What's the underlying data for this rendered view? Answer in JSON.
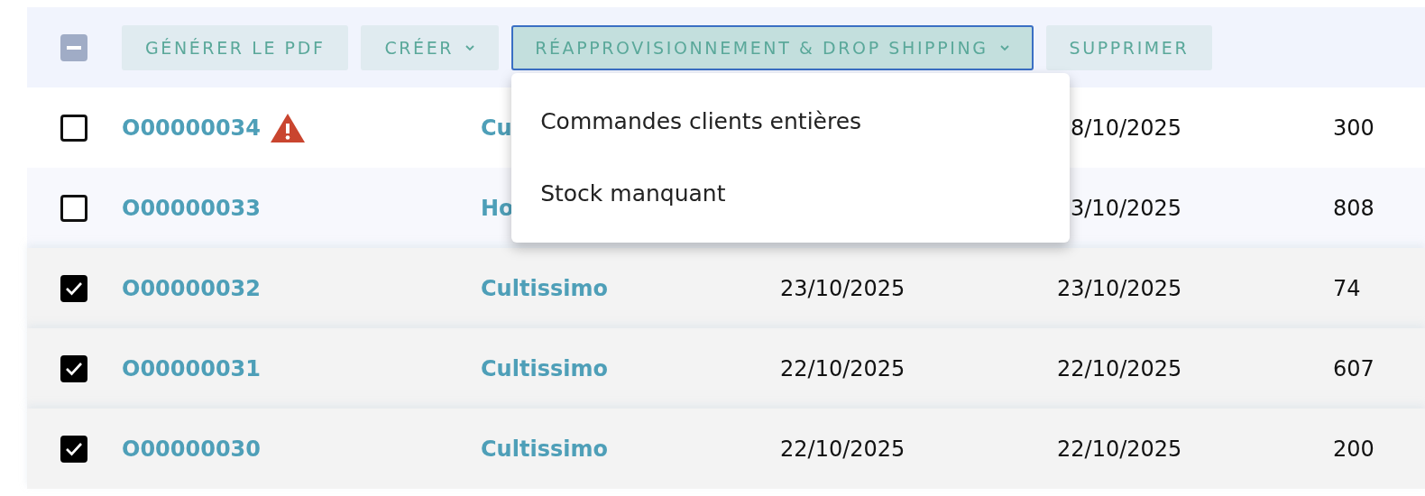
{
  "toolbar": {
    "select_all": {
      "indeterminate": true
    },
    "buttons": [
      {
        "label": "GÉNÉRER LE PDF",
        "has_caret": false,
        "selected": false
      },
      {
        "label": "CRÉER",
        "has_caret": true,
        "selected": false
      },
      {
        "label": "RÉAPPROVISIONNEMENT & DROP SHIPPING",
        "has_caret": true,
        "selected": true
      },
      {
        "label": "SUPPRIMER",
        "has_caret": false,
        "selected": false
      }
    ]
  },
  "dropdown_menu": {
    "items": [
      "Commandes clients entières",
      "Stock manquant"
    ]
  },
  "rows": [
    {
      "checked": false,
      "column_1": "O00000034",
      "warning": true,
      "column_2": "Cu",
      "column_4": "8/10/2025",
      "column_5": "300"
    },
    {
      "checked": false,
      "column_1": "O00000033",
      "warning": false,
      "column_2": "Ho",
      "column_4": "3/10/2025",
      "column_5": "808"
    },
    {
      "checked": true,
      "column_1": "O00000032",
      "warning": false,
      "column_2": "Cultissimo",
      "column_3": "23/10/2025",
      "column_4": "23/10/2025",
      "column_5": "74"
    },
    {
      "checked": true,
      "column_1": "O00000031",
      "warning": false,
      "column_2": "Cultissimo",
      "column_3": "22/10/2025",
      "column_4": "22/10/2025",
      "column_5": "607"
    },
    {
      "checked": true,
      "column_1": "O00000030",
      "warning": false,
      "column_2": "Cultissimo",
      "column_3": "22/10/2025",
      "column_4": "22/10/2025",
      "column_5": "200"
    }
  ]
}
